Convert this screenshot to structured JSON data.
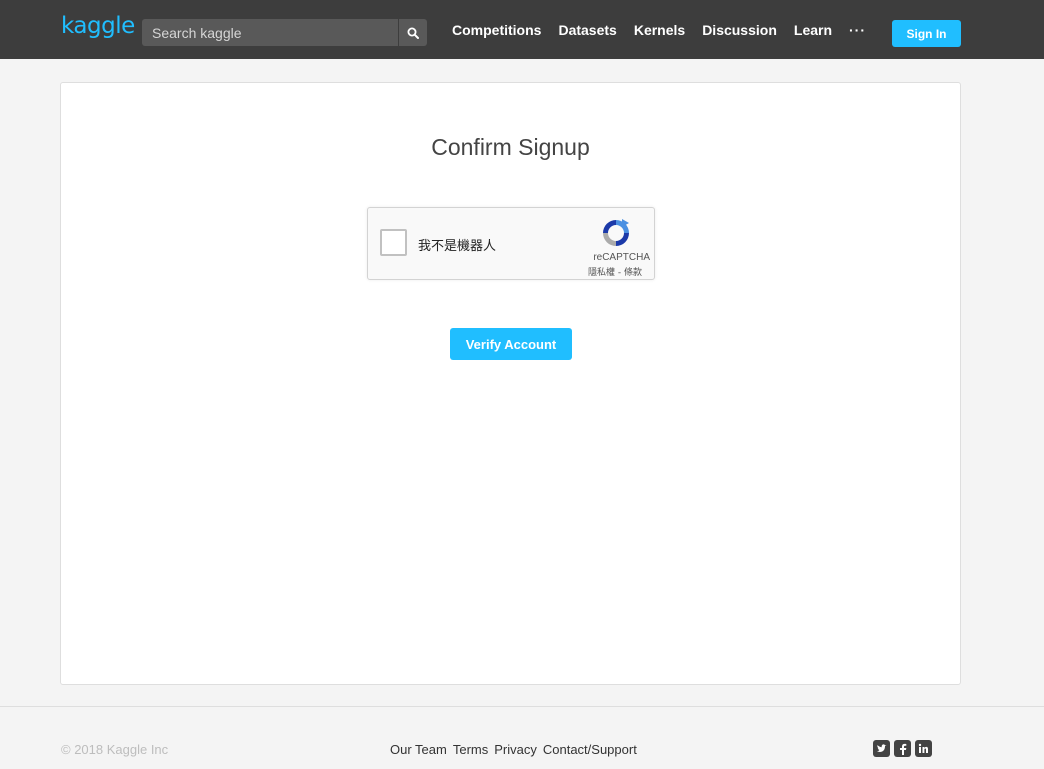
{
  "header": {
    "logo": "kaggle",
    "search": {
      "placeholder": "Search kaggle",
      "value": ""
    },
    "nav": [
      {
        "label": "Competitions"
      },
      {
        "label": "Datasets"
      },
      {
        "label": "Kernels"
      },
      {
        "label": "Discussion"
      },
      {
        "label": "Learn"
      }
    ],
    "more": "···",
    "signin_label": "Sign In",
    "icons": {
      "search": "search-icon"
    }
  },
  "main": {
    "title": "Confirm Signup",
    "recaptcha": {
      "label": "我不是機器人",
      "brand": "reCAPTCHA",
      "privacy": "隱私權",
      "separator": " - ",
      "terms": "條款",
      "icon": "recaptcha-logo-icon"
    },
    "verify_label": "Verify Account"
  },
  "footer": {
    "copyright": "© 2018 Kaggle Inc",
    "links": [
      {
        "label": "Our Team"
      },
      {
        "label": "Terms"
      },
      {
        "label": "Privacy"
      },
      {
        "label": "Contact/Support"
      }
    ],
    "social": [
      "twitter-icon",
      "facebook-icon",
      "linkedin-icon"
    ]
  },
  "colors": {
    "accent": "#20beff",
    "topbar": "#3d3d3d",
    "background": "#f4f4f4",
    "card": "#ffffff"
  }
}
